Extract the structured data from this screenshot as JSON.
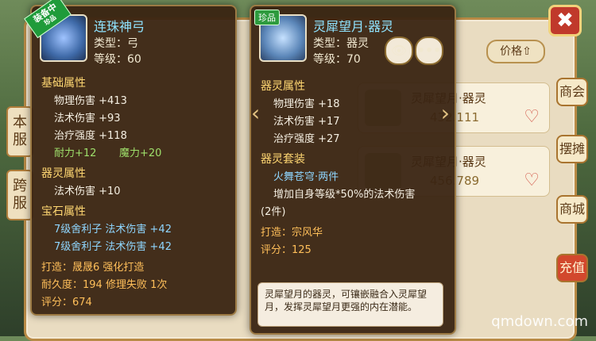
{
  "close_icon": "✖",
  "side_tabs": {
    "server_local": "本服",
    "server_cross": "跨服"
  },
  "right_tabs": [
    "商会",
    "摆摊",
    "商城",
    "充值"
  ],
  "price_sort": "价格⇧",
  "list": [
    {
      "name": "灵犀望月·器灵",
      "price": "432.111"
    },
    {
      "name": "灵犀望月·器灵",
      "price": "456.789"
    }
  ],
  "tip_left": {
    "ribbon": "装备中",
    "ribbon_sub": "珍品",
    "title": "连珠神弓",
    "type": "类型：弓",
    "level": "等级：60",
    "sec_base": "基础属性",
    "stats_base": [
      "物理伤害  +413",
      "法术伤害  +93",
      "治疗强度  +118"
    ],
    "stat_endure": "耐力+12",
    "stat_magic": "魔力+20",
    "sec_spirit": "器灵属性",
    "stat_spirit": "法术伤害  +10",
    "sec_gem": "宝石属性",
    "gem_1": "7级舍利子  法术伤害  +42",
    "gem_2": "7级舍利子  法术伤害  +42",
    "maker": "打造：晟晟6  强化打造",
    "durability": "耐久度：194  修理失败  1次",
    "score": "评分：674"
  },
  "tip_right": {
    "badge": "珍品",
    "title": "灵犀望月·器灵",
    "type": "类型：器灵",
    "level": "等级：70",
    "eye": "👁",
    "more": "•••",
    "sec_spirit": "器灵属性",
    "stats": [
      "物理伤害  +18",
      "法术伤害  +17",
      "治疗强度  +27"
    ],
    "sec_set": "器灵套装",
    "set_name": "火舞苍穹·两件",
    "set_desc": "增加自身等级*50%的法术伤害",
    "set_count": "(2件)",
    "maker": "打造：宗风华",
    "score": "评分：125",
    "description": "灵犀望月的器灵，可镶嵌融合入灵犀望月，发挥灵犀望月更强的内在潜能。"
  },
  "watermark": "qmdown.com"
}
